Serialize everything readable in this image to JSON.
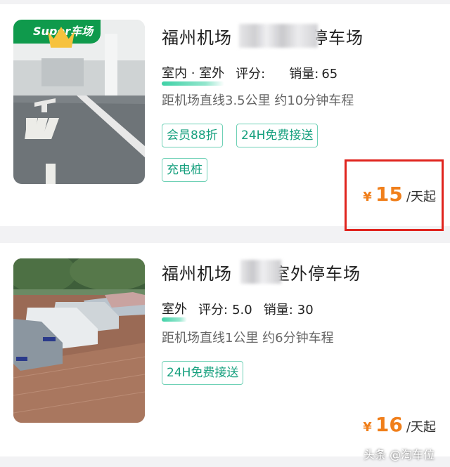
{
  "listings": [
    {
      "badge": "Super车场",
      "title_prefix": "福州机场",
      "title_suffix": "停车场",
      "type": "室内 · 室外",
      "rating_label": "评分:",
      "rating_value": "",
      "sales_label": "销量:",
      "sales_value": "65",
      "distance": "距机场直线3.5公里 约10分钟车程",
      "tags": [
        "会员88折",
        "24H免费接送",
        "充电桩"
      ],
      "price_symbol": "¥",
      "price": "15",
      "price_unit": "/天起"
    },
    {
      "title_prefix": "福州机场",
      "title_suffix": "室外停车场",
      "type": "室外",
      "rating_label": "评分:",
      "rating_value": "5.0",
      "sales_label": "销量:",
      "sales_value": "30",
      "distance": "距机场直线1公里 约6分钟车程",
      "tags": [
        "24H免费接送"
      ],
      "price_symbol": "¥",
      "price": "16",
      "price_unit": "/天起"
    }
  ],
  "watermark": "头条 @淘车位",
  "colors": {
    "accent_green": "#16a07e",
    "price_orange": "#f07f1b",
    "highlight_red": "#e0241e",
    "badge_green": "#0f9a4c"
  },
  "icons": [
    "crown-icon"
  ]
}
